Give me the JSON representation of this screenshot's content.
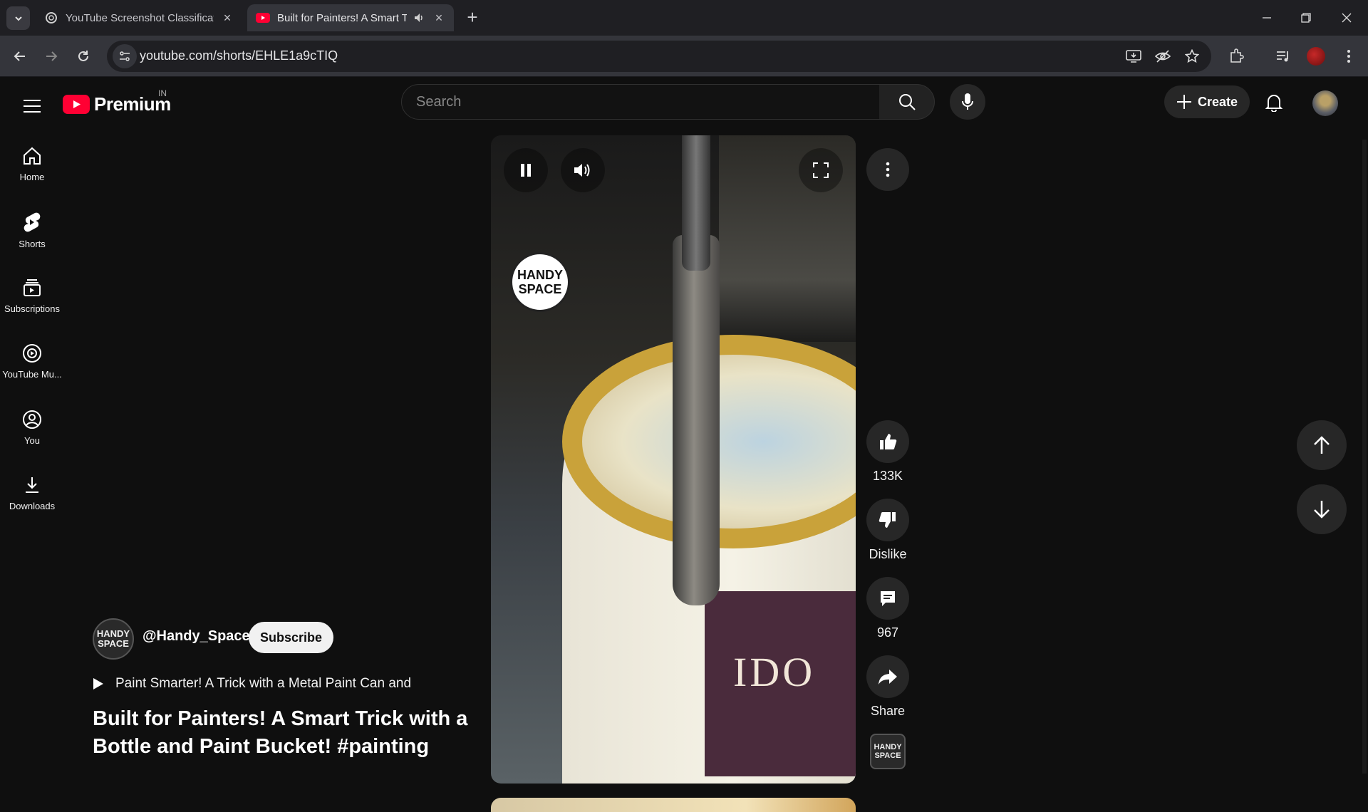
{
  "browser": {
    "tabs": [
      {
        "title": "YouTube Screenshot Classificati",
        "active": false
      },
      {
        "title": "Built for Painters! A Smart T",
        "active": true,
        "audio": true
      }
    ],
    "url": "youtube.com/shorts/EHLE1a9cTIQ"
  },
  "header": {
    "logo_text": "Premium",
    "country": "IN",
    "search_placeholder": "Search",
    "create_label": "Create"
  },
  "sidebar": {
    "items": [
      {
        "label": "Home",
        "icon": "home-icon"
      },
      {
        "label": "Shorts",
        "icon": "shorts-icon"
      },
      {
        "label": "Subscriptions",
        "icon": "subscriptions-icon"
      },
      {
        "label": "YouTube Mu...",
        "icon": "youtube-music-icon"
      },
      {
        "label": "You",
        "icon": "you-icon"
      },
      {
        "label": "Downloads",
        "icon": "downloads-icon"
      }
    ]
  },
  "video": {
    "watermark_line1": "HANDY",
    "watermark_line2": "SPACE",
    "bucket_label": "IDO"
  },
  "channel": {
    "avatar_line1": "HANDY",
    "avatar_line2": "SPACE",
    "handle": "@Handy_Space",
    "subscribe_label": "Subscribe"
  },
  "playlist_text": "Paint Smarter! A Trick with a Metal Paint Can and",
  "title": "Built for Painters! A Smart Trick with a Bottle and Paint Bucket! #painting",
  "actions": {
    "likes": "133K",
    "dislike_label": "Dislike",
    "comments": "967",
    "share_label": "Share",
    "sound_line1": "HANDY",
    "sound_line2": "SPACE"
  },
  "colors": {
    "page_bg": "#0f0f0f",
    "youtube_red": "#ff0033",
    "button_bg": "#272727"
  }
}
